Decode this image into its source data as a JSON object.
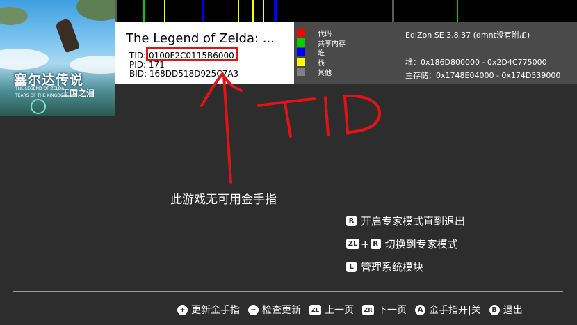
{
  "game": {
    "title": "The Legend of Zelda: ...",
    "tid_line": "TID: 0100F2C0115B6000",
    "pid_line": "PID: 171",
    "bid_line": "BID: 168DD518D925C7A3",
    "cover": {
      "title_cn": "塞尔达传说",
      "title_en_1": "THE LEGEND OF ZELDA",
      "title_en_2": "TEARS OF THE KINGDOM",
      "subtitle_cn": "王国之泪"
    }
  },
  "legend": [
    {
      "label": "代码",
      "color": "#ff0000"
    },
    {
      "label": "共享内存",
      "color": "#00cc00"
    },
    {
      "label": "堆",
      "color": "#0000ff"
    },
    {
      "label": "栈",
      "color": "#ffff00"
    },
    {
      "label": "其他",
      "color": "#808080"
    }
  ],
  "stats": {
    "version": "EdiZon SE 3.8.37 (dmnt没有附加)",
    "heap": "堆：0x186D800000 - 0x2D4C775000",
    "main": "主存储：0x1748E04000 - 0x174D539000"
  },
  "annotation": {
    "label": "TID",
    "color": "#e01414"
  },
  "message": "此游戏无可用金手指",
  "options": [
    {
      "keys": [
        "R"
      ],
      "label": "开启专家模式直到退出"
    },
    {
      "keys": [
        "ZL",
        "R"
      ],
      "label": "切换到专家模式"
    },
    {
      "keys": [
        "L"
      ],
      "label": "管理系统模块"
    }
  ],
  "footer": [
    {
      "icon": "plus-icon",
      "glyph": "+",
      "label": "更新金手指"
    },
    {
      "icon": "minus-icon",
      "glyph": "−",
      "label": "检查更新"
    },
    {
      "icon": "zl-button-icon",
      "glyph": "ZL",
      "label": "上一页"
    },
    {
      "icon": "zr-button-icon",
      "glyph": "ZR",
      "label": "下一页"
    },
    {
      "icon": "a-button-icon",
      "glyph": "A",
      "label": "金手指开|关"
    },
    {
      "icon": "b-button-icon",
      "glyph": "B",
      "label": "退出"
    }
  ]
}
